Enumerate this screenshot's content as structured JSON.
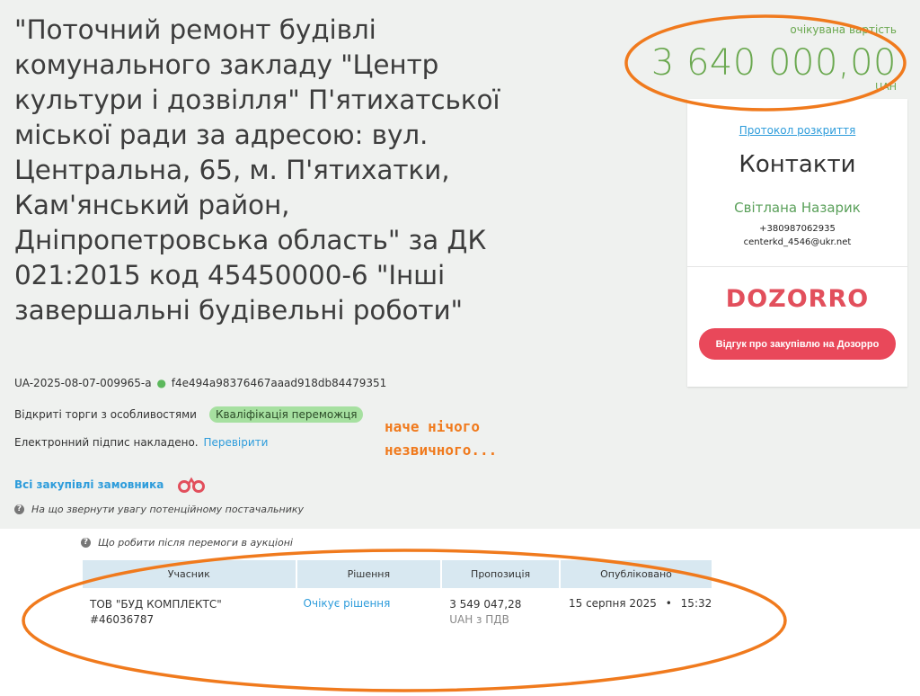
{
  "tender": {
    "title": "\"Поточний ремонт будівлі комунального закладу \"Центр культури і дозвілля\" П'ятихатської міської ради за адресою: вул. Центральна, 65, м. П'ятихатки, Кам'янський район, Дніпропетровська область\" за ДК 021:2015 код 45450000-6 \"Інші завершальні будівельні роботи\"",
    "id": "UA-2025-08-07-009965-a",
    "hash": "f4e494a98376467aaad918db84479351",
    "procedure_type": "Відкриті торги з особливостями",
    "status_badge": "Кваліфікація переможця",
    "signature_text": "Електронний підпис накладено.",
    "verify_link": "Перевірити",
    "all_purchases_link": "Всі закупівлі замовника",
    "supplier_hint": "На що звернути увагу потенційному постачальнику"
  },
  "annotation": {
    "line1": "наче нічого",
    "line2": "незвичного..."
  },
  "price": {
    "label": "очікувана вартість",
    "value": "3 640 000,00",
    "currency": "UAH"
  },
  "sidebar": {
    "protocol_link": "Протокол розкриття",
    "contacts_title": "Контакти",
    "contact_name": "Світлана Назарик",
    "contact_phone": "+380987062935",
    "contact_email": "centerkd_4546@ukr.net",
    "dozorro_logo": "DOZORRO",
    "dozorro_button": "Відгук про закупівлю на Дозорро"
  },
  "auction": {
    "after_win_hint": "Що робити після перемоги в аукціоні",
    "columns": [
      "Учасник",
      "Рішення",
      "Пропозиція",
      "Опубліковано"
    ],
    "rows": [
      {
        "participant_name": "ТОВ \"БУД КОМПЛЕКТС\"",
        "participant_code": "#46036787",
        "decision": "Очікує рішення",
        "offer_amount": "3 549 047,28",
        "offer_vat": "UAH з ПДВ",
        "published_date": "15 серпня 2025",
        "published_time": "15:32"
      }
    ]
  },
  "colors": {
    "accent_green": "#6aa84f",
    "link_blue": "#2d9cdb",
    "dozorro_red": "#e9485a",
    "annotation_orange": "#f07a1d"
  }
}
